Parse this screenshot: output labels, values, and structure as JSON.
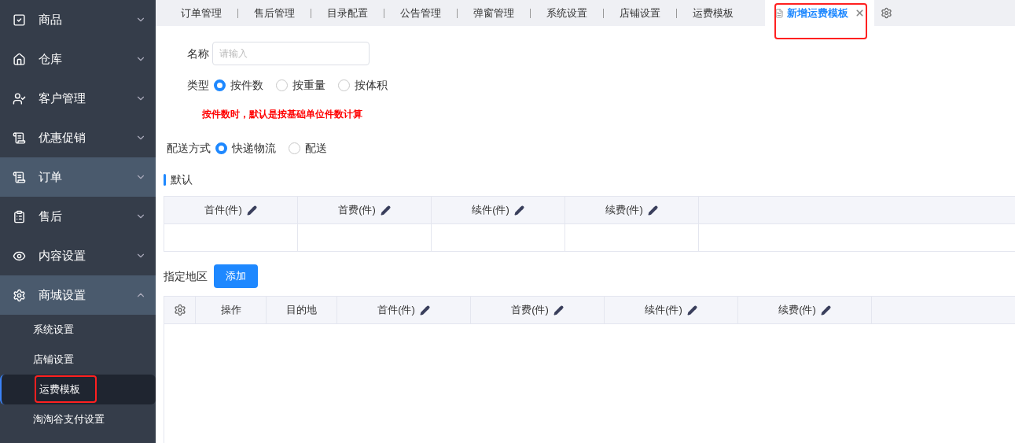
{
  "sidebar": {
    "items": [
      {
        "label": "商品",
        "expanded": false,
        "selected": false
      },
      {
        "label": "仓库",
        "expanded": false,
        "selected": false
      },
      {
        "label": "客户管理",
        "expanded": false,
        "selected": false
      },
      {
        "label": "优惠促销",
        "expanded": false,
        "selected": false
      },
      {
        "label": "订单",
        "expanded": false,
        "selected": true
      },
      {
        "label": "售后",
        "expanded": false,
        "selected": false
      },
      {
        "label": "内容设置",
        "expanded": false,
        "selected": false
      },
      {
        "label": "商城设置",
        "expanded": true,
        "selected": true,
        "children": [
          {
            "label": "系统设置",
            "selected": false,
            "highlighted": false
          },
          {
            "label": "店铺设置",
            "selected": false,
            "highlighted": false
          },
          {
            "label": "运费模板",
            "selected": true,
            "highlighted": true
          },
          {
            "label": "淘淘谷支付设置",
            "selected": false,
            "highlighted": false
          }
        ]
      }
    ]
  },
  "tabs": [
    {
      "label": "订单管理",
      "selected": false,
      "closable": false,
      "highlighted": false
    },
    {
      "label": "售后管理",
      "selected": false,
      "closable": false,
      "highlighted": false
    },
    {
      "label": "目录配置",
      "selected": false,
      "closable": false,
      "highlighted": false
    },
    {
      "label": "公告管理",
      "selected": false,
      "closable": false,
      "highlighted": false
    },
    {
      "label": "弹窗管理",
      "selected": false,
      "closable": false,
      "highlighted": false
    },
    {
      "label": "系统设置",
      "selected": false,
      "closable": false,
      "highlighted": false
    },
    {
      "label": "店铺设置",
      "selected": false,
      "closable": false,
      "highlighted": false
    },
    {
      "label": "运费模板",
      "selected": false,
      "closable": false,
      "highlighted": false
    },
    {
      "label": "新增运费模板",
      "selected": true,
      "closable": true,
      "highlighted": true
    }
  ],
  "form": {
    "name": {
      "label": "名称",
      "placeholder": "请输入"
    },
    "type": {
      "label": "类型",
      "options": [
        {
          "label": "按件数",
          "selected": true
        },
        {
          "label": "按重量",
          "selected": false
        },
        {
          "label": "按体积",
          "selected": false
        }
      ]
    },
    "hint": "按件数时，默认是按基础单位件数计算",
    "delivery": {
      "label": "配送方式",
      "options": [
        {
          "label": "快递物流",
          "selected": true
        },
        {
          "label": "配送",
          "selected": false
        }
      ]
    }
  },
  "default_section": {
    "title": "默认",
    "columns": [
      "首件(件)",
      "首费(件)",
      "续件(件)",
      "续费(件)"
    ]
  },
  "region_section": {
    "label": "指定地区",
    "add_button": "添加",
    "columns": [
      {
        "label": "操作",
        "editable": false
      },
      {
        "label": "目的地",
        "editable": false
      },
      {
        "label": "首件(件)",
        "editable": true
      },
      {
        "label": "首费(件)",
        "editable": true
      },
      {
        "label": "续件(件)",
        "editable": true
      },
      {
        "label": "续费(件)",
        "editable": true
      }
    ]
  }
}
